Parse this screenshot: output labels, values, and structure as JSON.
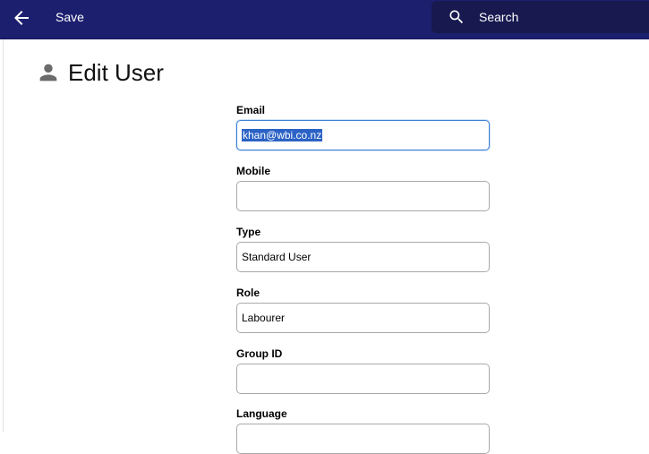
{
  "toolbar": {
    "back_icon": "arrow-left-icon",
    "save_label": "Save",
    "search_placeholder": "Search",
    "search_icon": "search-icon",
    "bar_color": "#1c1f6e"
  },
  "page": {
    "title": "Edit User",
    "title_icon": "user-icon"
  },
  "form": {
    "email": {
      "label": "Email",
      "value": "khan@wbi.co.nz",
      "selected": true
    },
    "mobile": {
      "label": "Mobile",
      "value": ""
    },
    "type": {
      "label": "Type",
      "value": "Standard User"
    },
    "role": {
      "label": "Role",
      "value": "Labourer"
    },
    "group_id": {
      "label": "Group ID",
      "value": ""
    },
    "language": {
      "label": "Language",
      "value": ""
    }
  }
}
